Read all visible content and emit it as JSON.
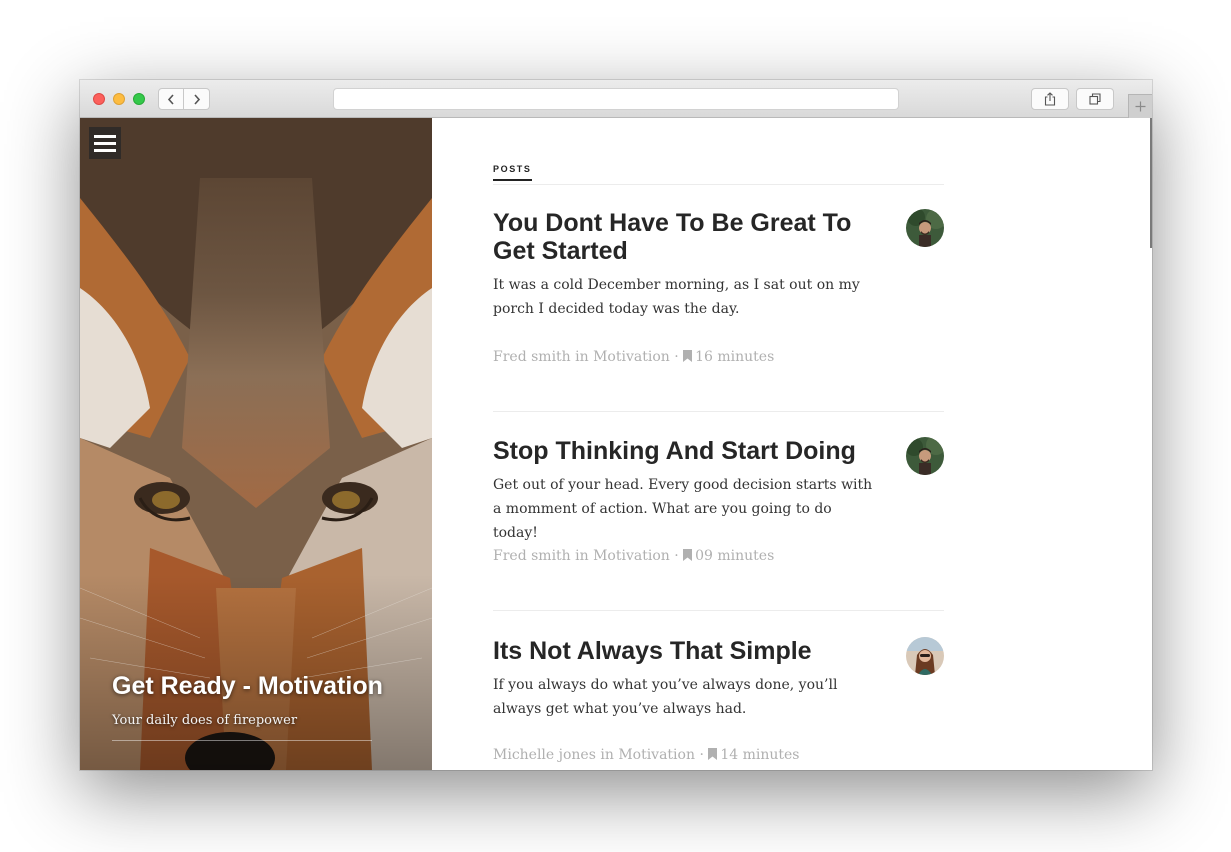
{
  "browser": {
    "url": "",
    "icons": {
      "back": "chevron-left-icon",
      "forward": "chevron-right-icon",
      "share": "share-icon",
      "tabs": "tabs-icon",
      "new_tab": "plus-icon"
    }
  },
  "hero": {
    "title": "Get Ready - Motivation",
    "subtitle": "Your daily does of firepower",
    "menu_icon": "hamburger-menu-icon"
  },
  "posts": {
    "section_label": "POSTS",
    "items": [
      {
        "title": "You Dont Have To Be Great To Get Started",
        "excerpt": "It was a cold December morning, as I sat out on my porch I decided today was the day.",
        "author": "Fred smith",
        "in": "in",
        "category": "Motivation",
        "separator": "·",
        "read_time": "16 minutes",
        "avatar_icon": "author-avatar"
      },
      {
        "title": "Stop Thinking And Start Doing",
        "excerpt": "Get out of your head. Every good decision starts with a momment of action. What are you going to do today!",
        "author": "Fred smith",
        "in": "in",
        "category": "Motivation",
        "separator": "·",
        "read_time": "09 minutes",
        "avatar_icon": "author-avatar"
      },
      {
        "title": "Its Not Always That Simple",
        "excerpt": "If you always do what you’ve always done, you’ll always get what you’ve always had.",
        "author": "Michelle jones",
        "in": "in",
        "category": "Motivation",
        "separator": "·",
        "read_time": "14 minutes",
        "avatar_icon": "author-avatar"
      }
    ]
  },
  "colors": {
    "text_dark": "#262626",
    "text_meta": "#b0b0b0",
    "traffic_red": "#fc605c",
    "traffic_yellow": "#fdbc40",
    "traffic_green": "#34c84a"
  }
}
